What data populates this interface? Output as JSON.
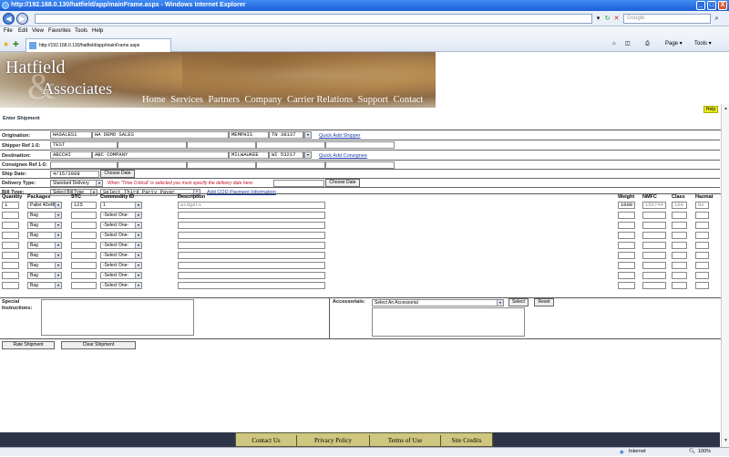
{
  "window": {
    "title": "http://192.168.0.130/hatfield/app/mainFrame.aspx - Windows Internet Explorer",
    "minimize": "_",
    "maximize": "□",
    "close": "X"
  },
  "browser": {
    "search_placeholder": "Google",
    "tab_title": "http://192.168.0.130/hatfield/app/mainFrame.aspx",
    "menu": [
      "File",
      "Edit",
      "View",
      "Favorites",
      "Tools",
      "Help"
    ],
    "page_btn": "Page ▾",
    "tools_btn": "Tools ▾"
  },
  "banner": {
    "logo_line1": "Hatfield",
    "logo_amp": "&",
    "logo_line2": "Associates",
    "nav": [
      "Home",
      "Services",
      "Partners",
      "Company",
      "Carrier Relations",
      "Support",
      "Contact"
    ]
  },
  "page": {
    "heading": "Enter Shipment",
    "top_button": "Help"
  },
  "form": {
    "origination": {
      "label": "Origination:",
      "code": "HASALES1",
      "name": "HA DEMO SALES",
      "city": "MEMPHIS",
      "state_zip": "TN 38137",
      "link": "Quick Add Shipper"
    },
    "shipper_ref": {
      "label": "Shipper Ref 1-5:",
      "value": "TEST"
    },
    "destination": {
      "label": "Destination:",
      "code": "ABCCHI",
      "name": "ABC COMPANY",
      "city": "MILWAUKEE",
      "state_zip": "WI 53217",
      "link": "Quick Add Consignee"
    },
    "consignee_ref": {
      "label": "Consignee Ref 1-5:"
    },
    "ship_date": {
      "label": "Ship Date:",
      "value": "4/15/2008",
      "button": "Choose Date"
    },
    "delivery_type": {
      "label": "Delivery Type:",
      "value": "Standard Delivery",
      "warning": "When \"Time Critical\" is selected you must specify the delivery date here:",
      "button": "Choose Date"
    },
    "bill_type": {
      "label": "Bill Type:",
      "value": "Select Bill Type",
      "payer": "Select Third Party Payer",
      "link": "Add COD Payment Information"
    },
    "columns": {
      "quantity": "Quantity",
      "packages": "Packages",
      "stc": "STC",
      "commodity": "Commodity ID",
      "description": "Description",
      "weight": "Weight",
      "nmfc": "NMFC",
      "class": "Class",
      "hazmat": "Hazmat"
    },
    "first_row": {
      "quantity": "1",
      "package": "Pallet 40x48",
      "stc": "125",
      "commodity": "1",
      "description": "widgets",
      "weight": "1000",
      "nmfc": "156744 (L)",
      "class": "100",
      "hazmat": "No"
    },
    "other_rows": [
      {
        "package": "Bag",
        "commodity": "-Select One-"
      },
      {
        "package": "Bag",
        "commodity": "-Select One-"
      },
      {
        "package": "Bag",
        "commodity": "-Select One-"
      },
      {
        "package": "Bag",
        "commodity": "-Select One-"
      },
      {
        "package": "Bag",
        "commodity": "-Select One-"
      },
      {
        "package": "Bag",
        "commodity": "-Select One-"
      },
      {
        "package": "Bag",
        "commodity": "-Select One-"
      },
      {
        "package": "Bag",
        "commodity": "-Select One-"
      }
    ],
    "special_instructions": {
      "label": "Special Instructions:"
    },
    "accessorials": {
      "label": "Accessorials:",
      "value": "Select An Accessorial",
      "select_btn": "Select",
      "reset_btn": "Reset"
    },
    "rate_button": "Rate Shipment",
    "clear_button": "Clear     Shipment"
  },
  "footer": {
    "items": [
      "Contact Us",
      "Privacy Policy",
      "Terms of Use",
      "Site Credits"
    ]
  },
  "status": {
    "zone": "Internet",
    "zoom": "100%"
  }
}
